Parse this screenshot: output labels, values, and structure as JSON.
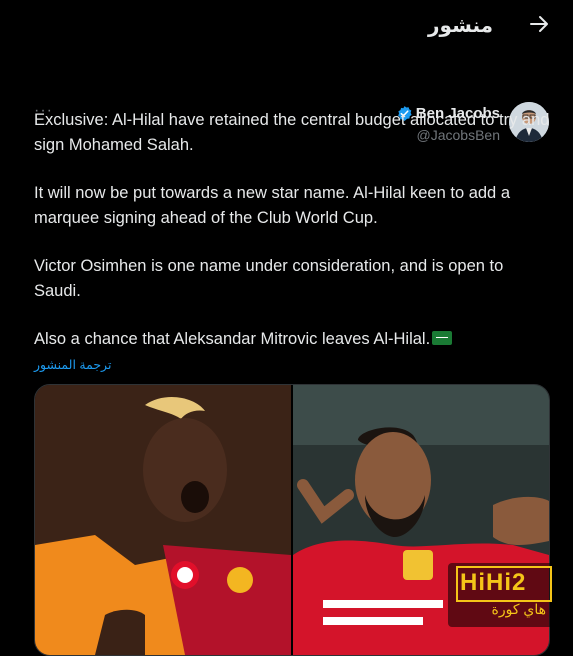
{
  "header": {
    "title": "منشور",
    "back_icon": "arrow-right-icon"
  },
  "author": {
    "name": "Ben Jacobs",
    "handle": "@JacobsBen",
    "verified": true,
    "more_label": "···"
  },
  "tweet": {
    "paragraphs": [
      "Exclusive: Al-Hilal have retained the central budget allocated to try and sign Mohamed Salah.",
      "It will now be put towards a new star name. Al-Hilal keen to add a marquee signing ahead of the Club World Cup.",
      "Victor Osimhen is one name under consideration, and is open to Saudi.",
      "Also a chance that Aleksandar Mitrovic leaves Al-Hilal."
    ],
    "flag_icon": "saudi-flag-icon",
    "translate_label": "ترجمة المنشور"
  },
  "media": {
    "images": [
      {
        "name": "osimhen-photo"
      },
      {
        "name": "salah-photo"
      }
    ]
  },
  "watermark": {
    "title": "HiHi2",
    "subtitle": "هاي كورة"
  },
  "colors": {
    "background": "#000000",
    "text": "#e7e9ea",
    "muted": "#71767b",
    "link": "#1d9bf0",
    "verified": "#1d9bf0",
    "watermark": "#f5c518"
  }
}
